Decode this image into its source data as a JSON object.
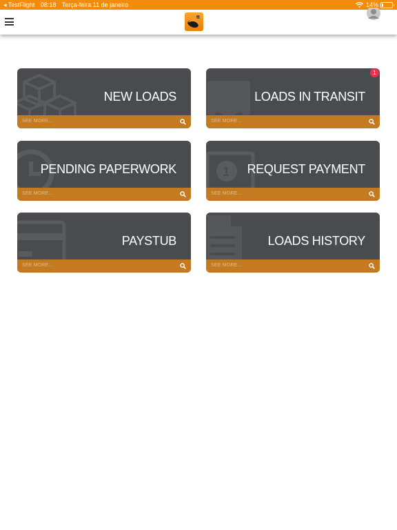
{
  "status_bar": {
    "app": "◂ TestFlight",
    "time": "08:18",
    "date": "Terça-feira 11 de janeiro",
    "battery": "14%"
  },
  "header": {
    "menu_icon": "hamburger-icon",
    "logo_icon": "app-logo",
    "avatar_icon": "user-avatar-icon"
  },
  "tiles": [
    {
      "title": "NEW LOADS",
      "see_more": "SEE MORE...",
      "icon": "boxes-icon"
    },
    {
      "title": "LOADS IN TRANSIT",
      "see_more": "SEE MORE...",
      "icon": "truck-icon",
      "badge": "1"
    },
    {
      "title": "PENDING PAPERWORK",
      "see_more": "SEE MORE...",
      "icon": "clock-icon"
    },
    {
      "title": "REQUEST PAYMENT",
      "see_more": "SEE MORE...",
      "icon": "money-icon"
    },
    {
      "title": "PAYSTUB",
      "see_more": "SEE MORE...",
      "icon": "credit-card-icon"
    },
    {
      "title": "LOADS HISTORY",
      "see_more": "SEE MORE...",
      "icon": "document-icon"
    }
  ],
  "colors": {
    "accent": "#f28c0c",
    "tile_bg": "#4a4b4f",
    "tile_footer": "#c47a20",
    "badge": "#e8334f"
  }
}
